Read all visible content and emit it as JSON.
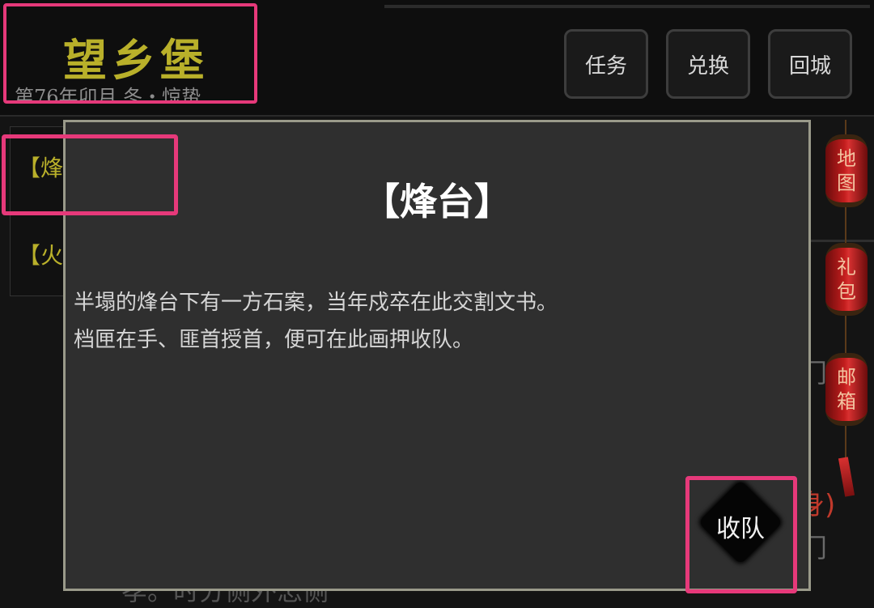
{
  "header": {
    "location_title": "望乡堡",
    "date": "第76年卯月 冬・惊蛰",
    "buttons": {
      "tasks": "任务",
      "exchange": "兑换",
      "return_city": "回城"
    }
  },
  "left_list": {
    "items": [
      {
        "label": "【烽台"
      },
      {
        "label": "【火垣"
      }
    ]
  },
  "side_menu": {
    "map": [
      "地",
      "图"
    ],
    "gift": [
      "礼",
      "包"
    ],
    "mail": [
      "邮",
      "箱"
    ]
  },
  "background_text": {
    "red_fragment": "身)",
    "grey_fragment_1": "门",
    "grey_fragment_2": "门",
    "bottom_fragment": "孝。时分侧外怎侧"
  },
  "dialog": {
    "title": "【烽台】",
    "description_lines": [
      "半塌的烽台下有一方石案，当年戍卒在此交割文书。",
      "档匣在手、匪首授首，便可在此画押收队。"
    ],
    "action_label": "收队"
  },
  "colors": {
    "highlight": "#e6397a",
    "location_gold": "#b9b02a",
    "lantern_red": "#c21d1d"
  }
}
